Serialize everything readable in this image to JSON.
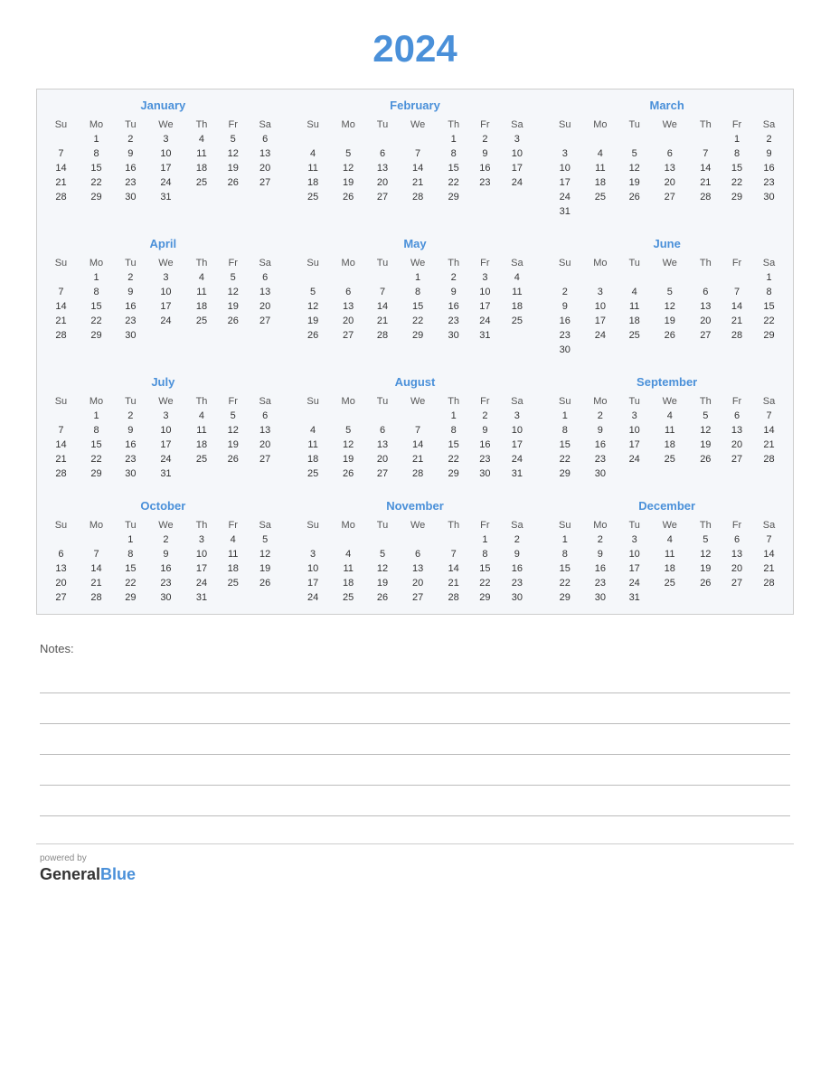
{
  "year": "2024",
  "months": [
    {
      "name": "January",
      "days_header": [
        "Su",
        "Mo",
        "Tu",
        "We",
        "Th",
        "Fr",
        "Sa"
      ],
      "weeks": [
        [
          "",
          "1",
          "2",
          "3",
          "4",
          "5",
          "6"
        ],
        [
          "7",
          "8",
          "9",
          "10",
          "11",
          "12",
          "13"
        ],
        [
          "14",
          "15",
          "16",
          "17",
          "18",
          "19",
          "20"
        ],
        [
          "21",
          "22",
          "23",
          "24",
          "25",
          "26",
          "27"
        ],
        [
          "28",
          "29",
          "30",
          "31",
          "",
          "",
          ""
        ]
      ]
    },
    {
      "name": "February",
      "days_header": [
        "Su",
        "Mo",
        "Tu",
        "We",
        "Th",
        "Fr",
        "Sa"
      ],
      "weeks": [
        [
          "",
          "",
          "",
          "",
          "1",
          "2",
          "3"
        ],
        [
          "4",
          "5",
          "6",
          "7",
          "8",
          "9",
          "10"
        ],
        [
          "11",
          "12",
          "13",
          "14",
          "15",
          "16",
          "17"
        ],
        [
          "18",
          "19",
          "20",
          "21",
          "22",
          "23",
          "24"
        ],
        [
          "25",
          "26",
          "27",
          "28",
          "29",
          "",
          ""
        ]
      ]
    },
    {
      "name": "March",
      "days_header": [
        "Su",
        "Mo",
        "Tu",
        "We",
        "Th",
        "Fr",
        "Sa"
      ],
      "weeks": [
        [
          "",
          "",
          "",
          "",
          "",
          "1",
          "2"
        ],
        [
          "3",
          "4",
          "5",
          "6",
          "7",
          "8",
          "9"
        ],
        [
          "10",
          "11",
          "12",
          "13",
          "14",
          "15",
          "16"
        ],
        [
          "17",
          "18",
          "19",
          "20",
          "21",
          "22",
          "23"
        ],
        [
          "24",
          "25",
          "26",
          "27",
          "28",
          "29",
          "30"
        ],
        [
          "31",
          "",
          "",
          "",
          "",
          "",
          ""
        ]
      ]
    },
    {
      "name": "April",
      "days_header": [
        "Su",
        "Mo",
        "Tu",
        "We",
        "Th",
        "Fr",
        "Sa"
      ],
      "weeks": [
        [
          "",
          "1",
          "2",
          "3",
          "4",
          "5",
          "6"
        ],
        [
          "7",
          "8",
          "9",
          "10",
          "11",
          "12",
          "13"
        ],
        [
          "14",
          "15",
          "16",
          "17",
          "18",
          "19",
          "20"
        ],
        [
          "21",
          "22",
          "23",
          "24",
          "25",
          "26",
          "27"
        ],
        [
          "28",
          "29",
          "30",
          "",
          "",
          "",
          ""
        ]
      ]
    },
    {
      "name": "May",
      "days_header": [
        "Su",
        "Mo",
        "Tu",
        "We",
        "Th",
        "Fr",
        "Sa"
      ],
      "weeks": [
        [
          "",
          "",
          "",
          "1",
          "2",
          "3",
          "4"
        ],
        [
          "5",
          "6",
          "7",
          "8",
          "9",
          "10",
          "11"
        ],
        [
          "12",
          "13",
          "14",
          "15",
          "16",
          "17",
          "18"
        ],
        [
          "19",
          "20",
          "21",
          "22",
          "23",
          "24",
          "25"
        ],
        [
          "26",
          "27",
          "28",
          "29",
          "30",
          "31",
          ""
        ]
      ]
    },
    {
      "name": "June",
      "days_header": [
        "Su",
        "Mo",
        "Tu",
        "We",
        "Th",
        "Fr",
        "Sa"
      ],
      "weeks": [
        [
          "",
          "",
          "",
          "",
          "",
          "",
          "1"
        ],
        [
          "2",
          "3",
          "4",
          "5",
          "6",
          "7",
          "8"
        ],
        [
          "9",
          "10",
          "11",
          "12",
          "13",
          "14",
          "15"
        ],
        [
          "16",
          "17",
          "18",
          "19",
          "20",
          "21",
          "22"
        ],
        [
          "23",
          "24",
          "25",
          "26",
          "27",
          "28",
          "29"
        ],
        [
          "30",
          "",
          "",
          "",
          "",
          "",
          ""
        ]
      ]
    },
    {
      "name": "July",
      "days_header": [
        "Su",
        "Mo",
        "Tu",
        "We",
        "Th",
        "Fr",
        "Sa"
      ],
      "weeks": [
        [
          "",
          "1",
          "2",
          "3",
          "4",
          "5",
          "6"
        ],
        [
          "7",
          "8",
          "9",
          "10",
          "11",
          "12",
          "13"
        ],
        [
          "14",
          "15",
          "16",
          "17",
          "18",
          "19",
          "20"
        ],
        [
          "21",
          "22",
          "23",
          "24",
          "25",
          "26",
          "27"
        ],
        [
          "28",
          "29",
          "30",
          "31",
          "",
          "",
          ""
        ]
      ]
    },
    {
      "name": "August",
      "days_header": [
        "Su",
        "Mo",
        "Tu",
        "We",
        "Th",
        "Fr",
        "Sa"
      ],
      "weeks": [
        [
          "",
          "",
          "",
          "",
          "1",
          "2",
          "3"
        ],
        [
          "4",
          "5",
          "6",
          "7",
          "8",
          "9",
          "10"
        ],
        [
          "11",
          "12",
          "13",
          "14",
          "15",
          "16",
          "17"
        ],
        [
          "18",
          "19",
          "20",
          "21",
          "22",
          "23",
          "24"
        ],
        [
          "25",
          "26",
          "27",
          "28",
          "29",
          "30",
          "31"
        ]
      ]
    },
    {
      "name": "September",
      "days_header": [
        "Su",
        "Mo",
        "Tu",
        "We",
        "Th",
        "Fr",
        "Sa"
      ],
      "weeks": [
        [
          "1",
          "2",
          "3",
          "4",
          "5",
          "6",
          "7"
        ],
        [
          "8",
          "9",
          "10",
          "11",
          "12",
          "13",
          "14"
        ],
        [
          "15",
          "16",
          "17",
          "18",
          "19",
          "20",
          "21"
        ],
        [
          "22",
          "23",
          "24",
          "25",
          "26",
          "27",
          "28"
        ],
        [
          "29",
          "30",
          "",
          "",
          "",
          "",
          ""
        ]
      ]
    },
    {
      "name": "October",
      "days_header": [
        "Su",
        "Mo",
        "Tu",
        "We",
        "Th",
        "Fr",
        "Sa"
      ],
      "weeks": [
        [
          "",
          "",
          "1",
          "2",
          "3",
          "4",
          "5"
        ],
        [
          "6",
          "7",
          "8",
          "9",
          "10",
          "11",
          "12"
        ],
        [
          "13",
          "14",
          "15",
          "16",
          "17",
          "18",
          "19"
        ],
        [
          "20",
          "21",
          "22",
          "23",
          "24",
          "25",
          "26"
        ],
        [
          "27",
          "28",
          "29",
          "30",
          "31",
          "",
          ""
        ]
      ]
    },
    {
      "name": "November",
      "days_header": [
        "Su",
        "Mo",
        "Tu",
        "We",
        "Th",
        "Fr",
        "Sa"
      ],
      "weeks": [
        [
          "",
          "",
          "",
          "",
          "",
          "1",
          "2"
        ],
        [
          "3",
          "4",
          "5",
          "6",
          "7",
          "8",
          "9"
        ],
        [
          "10",
          "11",
          "12",
          "13",
          "14",
          "15",
          "16"
        ],
        [
          "17",
          "18",
          "19",
          "20",
          "21",
          "22",
          "23"
        ],
        [
          "24",
          "25",
          "26",
          "27",
          "28",
          "29",
          "30"
        ]
      ]
    },
    {
      "name": "December",
      "days_header": [
        "Su",
        "Mo",
        "Tu",
        "We",
        "Th",
        "Fr",
        "Sa"
      ],
      "weeks": [
        [
          "1",
          "2",
          "3",
          "4",
          "5",
          "6",
          "7"
        ],
        [
          "8",
          "9",
          "10",
          "11",
          "12",
          "13",
          "14"
        ],
        [
          "15",
          "16",
          "17",
          "18",
          "19",
          "20",
          "21"
        ],
        [
          "22",
          "23",
          "24",
          "25",
          "26",
          "27",
          "28"
        ],
        [
          "29",
          "30",
          "31",
          "",
          "",
          "",
          ""
        ]
      ]
    }
  ],
  "notes": {
    "label": "Notes:",
    "lines": 5
  },
  "footer": {
    "powered_by": "powered by",
    "brand_general": "General",
    "brand_blue": "Blue"
  }
}
